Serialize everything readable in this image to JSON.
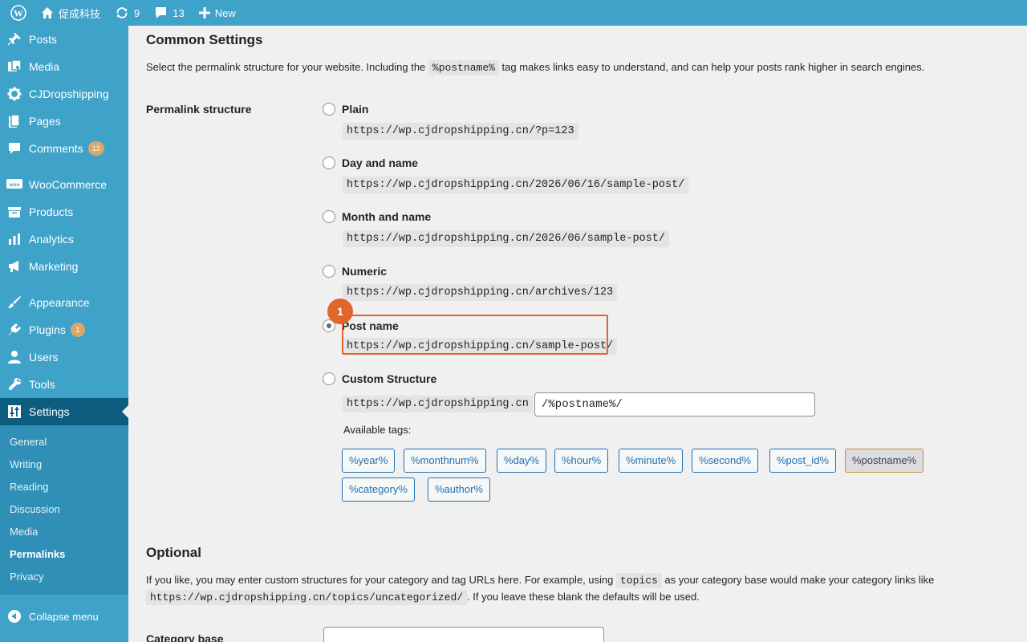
{
  "admin_bar": {
    "site_name": "促成科技",
    "updates_count": "9",
    "comments_count": "13",
    "new_label": "New"
  },
  "sidebar": {
    "items": [
      {
        "label": "Posts"
      },
      {
        "label": "Media"
      },
      {
        "label": "CJDropshipping"
      },
      {
        "label": "Pages"
      },
      {
        "label": "Comments",
        "badge": "13"
      },
      {
        "label": "WooCommerce"
      },
      {
        "label": "Products"
      },
      {
        "label": "Analytics"
      },
      {
        "label": "Marketing"
      },
      {
        "label": "Appearance"
      },
      {
        "label": "Plugins",
        "badge": "1"
      },
      {
        "label": "Users"
      },
      {
        "label": "Tools"
      },
      {
        "label": "Settings"
      }
    ],
    "submenu": [
      "General",
      "Writing",
      "Reading",
      "Discussion",
      "Media",
      "Permalinks",
      "Privacy"
    ],
    "collapse_label": "Collapse menu"
  },
  "common": {
    "heading": "Common Settings",
    "desc_before": "Select the permalink structure for your website. Including the ",
    "desc_code": "%postname%",
    "desc_after": " tag makes links easy to understand, and can help your posts rank higher in search engines.",
    "field_label": "Permalink structure",
    "options": [
      {
        "label": "Plain",
        "example": "https://wp.cjdropshipping.cn/?p=123"
      },
      {
        "label": "Day and name",
        "example": "https://wp.cjdropshipping.cn/2026/06/16/sample-post/"
      },
      {
        "label": "Month and name",
        "example": "https://wp.cjdropshipping.cn/2026/06/sample-post/"
      },
      {
        "label": "Numeric",
        "example": "https://wp.cjdropshipping.cn/archives/123"
      },
      {
        "label": "Post name",
        "example": "https://wp.cjdropshipping.cn/sample-post/"
      },
      {
        "label": "Custom Structure"
      }
    ],
    "selected_option": "Post name",
    "step_number": "1",
    "custom_prefix": "https://wp.cjdropshipping.cn",
    "custom_value": "/%postname%/",
    "available_tags_label": "Available tags:",
    "tags": [
      "%year%",
      "%monthnum%",
      "%day%",
      "%hour%",
      "%minute%",
      "%second%",
      "%post_id%",
      "%postname%",
      "%category%",
      "%author%"
    ],
    "active_tag": "%postname%"
  },
  "optional": {
    "heading": "Optional",
    "desc_before": "If you like, you may enter custom structures for your category and tag URLs here. For example, using ",
    "desc_code": "topics",
    "desc_middle": " as your category base would make your category links like",
    "desc_code2": "https://wp.cjdropshipping.cn/topics/uncategorized/",
    "desc_after": ". If you leave these blank the defaults will be used.",
    "category_base_label": "Category base"
  },
  "colors": {
    "sidebar_bg": "#3fa2c9",
    "current_menu_bg": "#0d5d80",
    "accent_orange": "#e0672a",
    "link_blue": "#2271b1"
  }
}
